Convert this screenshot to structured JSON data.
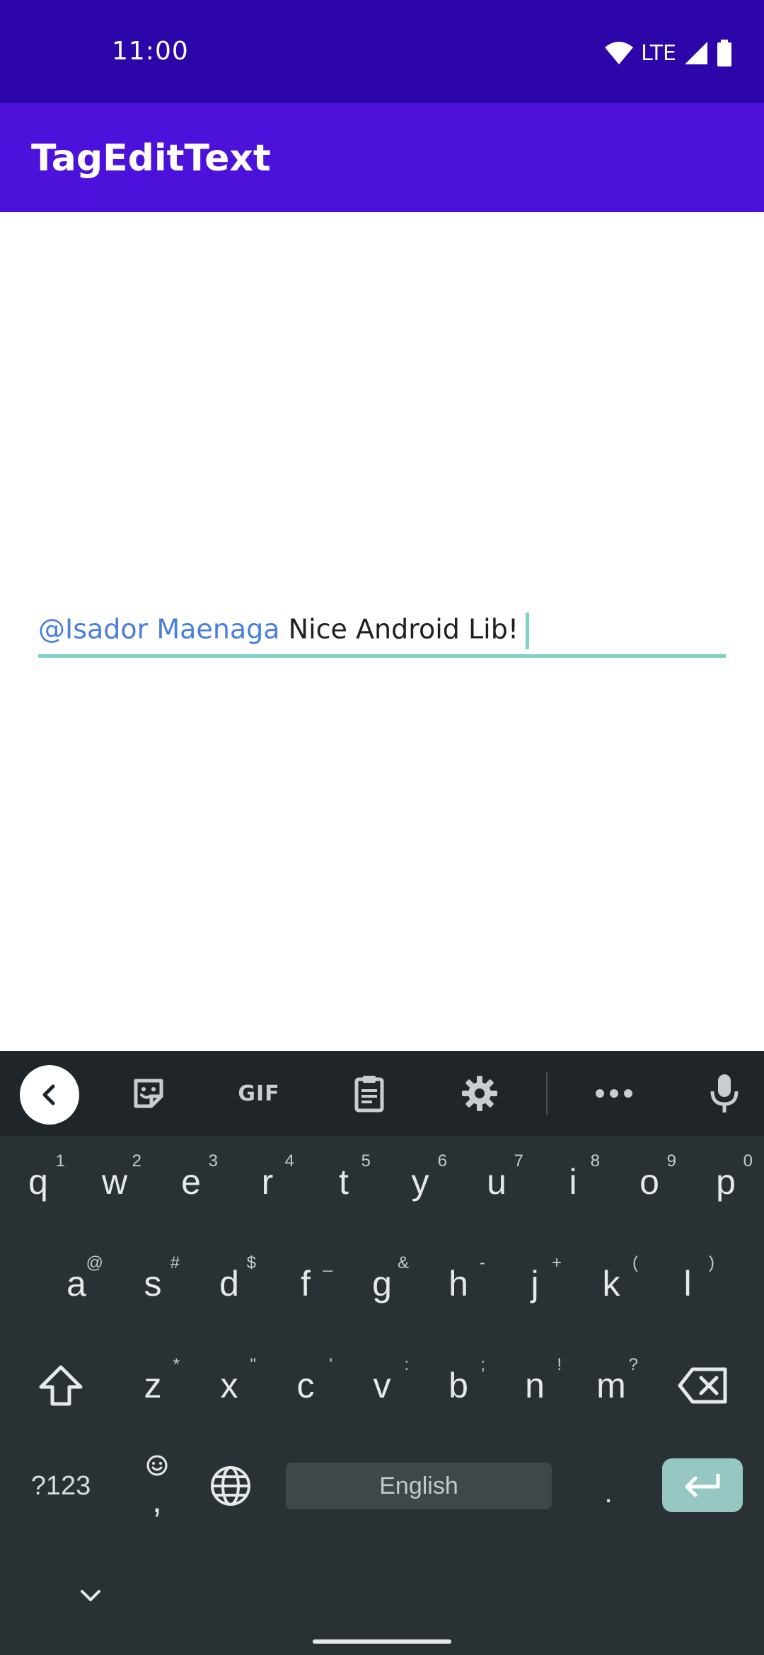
{
  "status_bar": {
    "time": "11:00",
    "network": "LTE"
  },
  "app_bar": {
    "title": "TagEditText"
  },
  "editor": {
    "tag": "@Isador Maenaga",
    "text": " Nice Android Lib!",
    "tag_color": "#4a7fdc",
    "underline_color": "#7fd2c8"
  },
  "keyboard": {
    "toolbar": [
      "back-icon",
      "sticker-icon",
      "gif",
      "clipboard-icon",
      "gear-icon",
      "more-icon",
      "mic-icon"
    ],
    "gif_label": "GIF",
    "row1": [
      {
        "key": "q",
        "hint": "1"
      },
      {
        "key": "w",
        "hint": "2"
      },
      {
        "key": "e",
        "hint": "3"
      },
      {
        "key": "r",
        "hint": "4"
      },
      {
        "key": "t",
        "hint": "5"
      },
      {
        "key": "y",
        "hint": "6"
      },
      {
        "key": "u",
        "hint": "7"
      },
      {
        "key": "i",
        "hint": "8"
      },
      {
        "key": "o",
        "hint": "9"
      },
      {
        "key": "p",
        "hint": "0"
      }
    ],
    "row2": [
      {
        "key": "a",
        "hint": "@"
      },
      {
        "key": "s",
        "hint": "#"
      },
      {
        "key": "d",
        "hint": "$"
      },
      {
        "key": "f",
        "hint": "_"
      },
      {
        "key": "g",
        "hint": "&"
      },
      {
        "key": "h",
        "hint": "-"
      },
      {
        "key": "j",
        "hint": "+"
      },
      {
        "key": "k",
        "hint": "("
      },
      {
        "key": "l",
        "hint": ")"
      }
    ],
    "row3": [
      {
        "key": "z",
        "hint": "*"
      },
      {
        "key": "x",
        "hint": "\""
      },
      {
        "key": "c",
        "hint": "'"
      },
      {
        "key": "v",
        "hint": ":"
      },
      {
        "key": "b",
        "hint": ";"
      },
      {
        "key": "n",
        "hint": "!"
      },
      {
        "key": "m",
        "hint": "?"
      }
    ],
    "symbols_label": "?123",
    "comma_label": ",",
    "space_label": "English",
    "period_label": ".",
    "accent_color": "#97c7c2"
  }
}
